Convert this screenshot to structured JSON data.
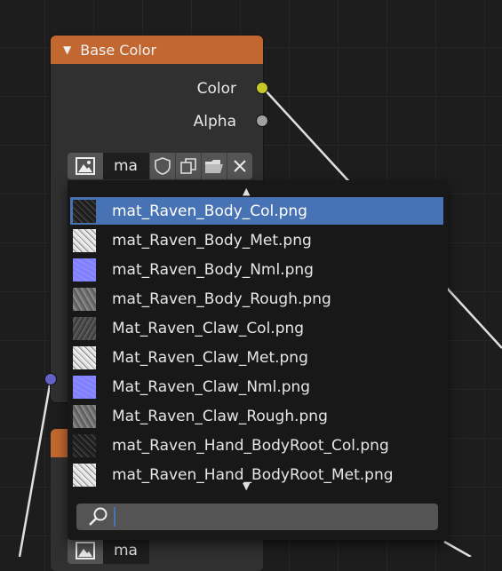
{
  "node": {
    "title": "Base Color",
    "collapse_icon": "triangle-down-icon",
    "outputs": [
      {
        "label": "Color",
        "socket_color": "#c7c729"
      },
      {
        "label": "Alpha",
        "socket_color": "#a1a1a1"
      }
    ],
    "image_name": "ma",
    "input_socket_color": "#6363c7",
    "header_color": "#c1672f"
  },
  "second_node": {
    "image_name": "ma"
  },
  "dropdown": {
    "selected_color": "#4772b3",
    "items": [
      {
        "label": "mat_Raven_Body_Col.png",
        "thumb": "dark"
      },
      {
        "label": "mat_Raven_Body_Met.png",
        "thumb": "white"
      },
      {
        "label": "mat_Raven_Body_Nml.png",
        "thumb": "normal"
      },
      {
        "label": "mat_Raven_Body_Rough.png",
        "thumb": "gray"
      },
      {
        "label": "Mat_Raven_Claw_Col.png",
        "thumb": "gray-dark"
      },
      {
        "label": "Mat_Raven_Claw_Met.png",
        "thumb": "white"
      },
      {
        "label": "Mat_Raven_Claw_Nml.png",
        "thumb": "normal"
      },
      {
        "label": "Mat_Raven_Claw_Rough.png",
        "thumb": "gray"
      },
      {
        "label": "mat_Raven_Hand_BodyRoot_Col.png",
        "thumb": "dark"
      },
      {
        "label": "mat_Raven_Hand_BodyRoot_Met.png",
        "thumb": "white"
      }
    ],
    "selected_index": 0,
    "search_value": ""
  }
}
